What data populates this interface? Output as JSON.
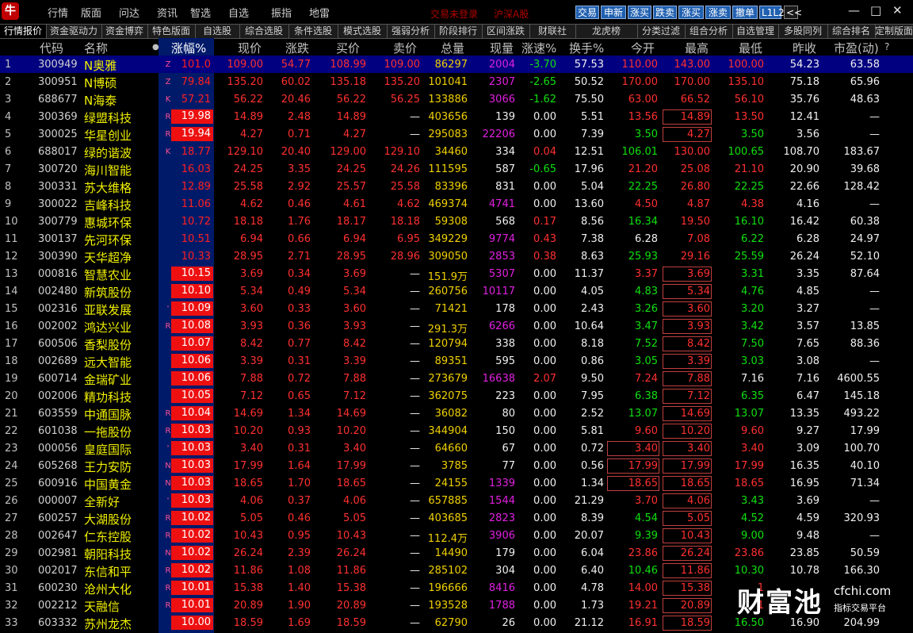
{
  "app": {
    "logo": "牛",
    "menu": [
      "行情",
      "版面",
      "问达",
      "资讯",
      "智选",
      "自选",
      "振指",
      "地雷"
    ],
    "status_left": "交易未登录",
    "status_right": "沪深A股",
    "buttons": [
      "交易",
      "申新",
      "涨买",
      "跌卖",
      "涨买",
      "涨卖",
      "撤单",
      "L1L2"
    ],
    "nav_icon": "chevron-left-icon",
    "win": [
      "—",
      "□",
      "✕"
    ]
  },
  "tabs": [
    "行情报价",
    "资金驱动力",
    "资金博弈",
    "特色版面",
    "自选股",
    "综合选股",
    "条件选股",
    "模式选股",
    "强弱分析",
    "阶段排行",
    "区间涨跌",
    "财联社",
    "龙虎榜",
    "分类过滤",
    "组合分析",
    "自选管理",
    "多股同列",
    "综合排名",
    "定制版面"
  ],
  "columns": [
    "代码",
    "名称",
    "",
    "涨幅%",
    "现价",
    "涨跌",
    "买价",
    "卖价",
    "总量",
    "现量",
    "涨速%",
    "换手%",
    "今开",
    "最高",
    "最低",
    "昨收",
    "市盈(动)",
    "?"
  ],
  "rows": [
    {
      "i": "1",
      "code": "300949",
      "name": "N奥雅",
      "tag": "Z",
      "pct": "101.0",
      "price": "109.00",
      "chg": "54.77",
      "bid": "108.99",
      "ask": "109.00",
      "vol": "86297",
      "cur": "2004",
      "spd": "-3.70",
      "turn": "57.53",
      "open": "110.00",
      "high": "143.00",
      "low": "100.00",
      "prev": "54.23",
      "pe": "63.58"
    },
    {
      "i": "2",
      "code": "300951",
      "name": "N博硕",
      "tag": "Z",
      "pct": "79.84",
      "price": "135.20",
      "chg": "60.02",
      "bid": "135.18",
      "ask": "135.20",
      "vol": "101041",
      "cur": "2307",
      "spd": "-2.65",
      "turn": "50.52",
      "open": "170.00",
      "high": "170.00",
      "low": "135.10",
      "prev": "75.18",
      "pe": "65.96"
    },
    {
      "i": "3",
      "code": "688677",
      "name": "N海泰",
      "tag": "K",
      "pct": "57.21",
      "price": "56.22",
      "chg": "20.46",
      "bid": "56.22",
      "ask": "56.25",
      "vol": "133886",
      "cur": "3066",
      "spd": "-1.62",
      "turn": "75.50",
      "open": "63.00",
      "high": "66.52",
      "low": "56.10",
      "prev": "35.76",
      "pe": "48.63"
    },
    {
      "i": "4",
      "code": "300369",
      "name": "绿盟科技",
      "tag": "R",
      "pct": "19.98",
      "price": "14.89",
      "chg": "2.48",
      "bid": "14.89",
      "ask": "—",
      "vol": "403656",
      "cur": "139",
      "spd": "0.00",
      "turn": "5.51",
      "open": "13.56",
      "high": "14.89",
      "low": "13.50",
      "prev": "12.41",
      "pe": "—"
    },
    {
      "i": "5",
      "code": "300025",
      "name": "华星创业",
      "tag": "R",
      "pct": "19.94",
      "price": "4.27",
      "chg": "0.71",
      "bid": "4.27",
      "ask": "—",
      "vol": "295083",
      "cur": "22206",
      "spd": "0.00",
      "turn": "7.39",
      "open": "3.50",
      "high": "4.27",
      "low": "3.50",
      "prev": "3.56",
      "pe": "—"
    },
    {
      "i": "6",
      "code": "688017",
      "name": "绿的谐波",
      "tag": "K",
      "pct": "18.77",
      "price": "129.10",
      "chg": "20.40",
      "bid": "129.00",
      "ask": "129.10",
      "vol": "34460",
      "cur": "334",
      "spd": "0.04",
      "turn": "12.51",
      "open": "106.01",
      "high": "130.00",
      "low": "100.65",
      "prev": "108.70",
      "pe": "183.67"
    },
    {
      "i": "7",
      "code": "300720",
      "name": "海川智能",
      "tag": "",
      "pct": "16.03",
      "price": "24.25",
      "chg": "3.35",
      "bid": "24.25",
      "ask": "24.26",
      "vol": "111595",
      "cur": "587",
      "spd": "-0.65",
      "turn": "17.96",
      "open": "21.20",
      "high": "25.08",
      "low": "21.10",
      "prev": "20.90",
      "pe": "39.68"
    },
    {
      "i": "8",
      "code": "300331",
      "name": "苏大维格",
      "tag": "",
      "pct": "12.89",
      "price": "25.58",
      "chg": "2.92",
      "bid": "25.57",
      "ask": "25.58",
      "vol": "83396",
      "cur": "831",
      "spd": "0.00",
      "turn": "5.04",
      "open": "22.25",
      "high": "26.80",
      "low": "22.25",
      "prev": "22.66",
      "pe": "128.42"
    },
    {
      "i": "9",
      "code": "300022",
      "name": "吉峰科技",
      "tag": "",
      "pct": "11.06",
      "price": "4.62",
      "chg": "0.46",
      "bid": "4.61",
      "ask": "4.62",
      "vol": "469374",
      "cur": "4741",
      "spd": "0.00",
      "turn": "13.60",
      "open": "4.50",
      "high": "4.87",
      "low": "4.38",
      "prev": "4.16",
      "pe": "—"
    },
    {
      "i": "10",
      "code": "300779",
      "name": "惠城环保",
      "tag": "",
      "pct": "10.72",
      "price": "18.18",
      "chg": "1.76",
      "bid": "18.17",
      "ask": "18.18",
      "vol": "59308",
      "cur": "568",
      "spd": "0.17",
      "turn": "8.56",
      "open": "16.34",
      "high": "19.50",
      "low": "16.10",
      "prev": "16.42",
      "pe": "60.38"
    },
    {
      "i": "11",
      "code": "300137",
      "name": "先河环保",
      "tag": "",
      "pct": "10.51",
      "price": "6.94",
      "chg": "0.66",
      "bid": "6.94",
      "ask": "6.95",
      "vol": "349229",
      "cur": "9774",
      "spd": "0.43",
      "turn": "7.38",
      "open": "6.28",
      "high": "7.08",
      "low": "6.22",
      "prev": "6.28",
      "pe": "24.97"
    },
    {
      "i": "12",
      "code": "300390",
      "name": "天华超净",
      "tag": "",
      "pct": "10.33",
      "price": "28.95",
      "chg": "2.71",
      "bid": "28.95",
      "ask": "28.96",
      "vol": "309050",
      "cur": "2853",
      "spd": "0.38",
      "turn": "8.63",
      "open": "25.93",
      "high": "29.16",
      "low": "25.59",
      "prev": "26.24",
      "pe": "52.10"
    },
    {
      "i": "13",
      "code": "000816",
      "name": "智慧农业",
      "tag": "",
      "pct": "10.15",
      "price": "3.69",
      "chg": "0.34",
      "bid": "3.69",
      "ask": "—",
      "vol": "151.9万",
      "cur": "5307",
      "spd": "0.00",
      "turn": "11.37",
      "open": "3.37",
      "high": "3.69",
      "low": "3.31",
      "prev": "3.35",
      "pe": "87.64"
    },
    {
      "i": "14",
      "code": "002480",
      "name": "新筑股份",
      "tag": "",
      "pct": "10.10",
      "price": "5.34",
      "chg": "0.49",
      "bid": "5.34",
      "ask": "—",
      "vol": "260756",
      "cur": "10117",
      "spd": "0.00",
      "turn": "4.05",
      "open": "4.83",
      "high": "5.34",
      "low": "4.76",
      "prev": "4.85",
      "pe": "—"
    },
    {
      "i": "15",
      "code": "002316",
      "name": "亚联发展",
      "tag": "'",
      "pct": "10.09",
      "price": "3.60",
      "chg": "0.33",
      "bid": "3.60",
      "ask": "—",
      "vol": "71421",
      "cur": "178",
      "spd": "0.00",
      "turn": "2.43",
      "open": "3.26",
      "high": "3.60",
      "low": "3.20",
      "prev": "3.27",
      "pe": "—"
    },
    {
      "i": "16",
      "code": "002002",
      "name": "鸿达兴业",
      "tag": "R",
      "pct": "10.08",
      "price": "3.93",
      "chg": "0.36",
      "bid": "3.93",
      "ask": "—",
      "vol": "291.3万",
      "cur": "6266",
      "spd": "0.00",
      "turn": "10.64",
      "open": "3.47",
      "high": "3.93",
      "low": "3.42",
      "prev": "3.57",
      "pe": "13.85"
    },
    {
      "i": "17",
      "code": "600506",
      "name": "香梨股份",
      "tag": "",
      "pct": "10.07",
      "price": "8.42",
      "chg": "0.77",
      "bid": "8.42",
      "ask": "—",
      "vol": "120794",
      "cur": "338",
      "spd": "0.00",
      "turn": "8.18",
      "open": "7.52",
      "high": "8.42",
      "low": "7.50",
      "prev": "7.65",
      "pe": "88.36"
    },
    {
      "i": "18",
      "code": "002689",
      "name": "远大智能",
      "tag": "",
      "pct": "10.06",
      "price": "3.39",
      "chg": "0.31",
      "bid": "3.39",
      "ask": "—",
      "vol": "89351",
      "cur": "595",
      "spd": "0.00",
      "turn": "0.86",
      "open": "3.05",
      "high": "3.39",
      "low": "3.03",
      "prev": "3.08",
      "pe": "—"
    },
    {
      "i": "19",
      "code": "600714",
      "name": "金瑞矿业",
      "tag": "",
      "pct": "10.06",
      "price": "7.88",
      "chg": "0.72",
      "bid": "7.88",
      "ask": "—",
      "vol": "273679",
      "cur": "16638",
      "spd": "2.07",
      "turn": "9.50",
      "open": "7.24",
      "high": "7.88",
      "low": "7.16",
      "prev": "7.16",
      "pe": "4600.55"
    },
    {
      "i": "20",
      "code": "002006",
      "name": "精功科技",
      "tag": "",
      "pct": "10.05",
      "price": "7.12",
      "chg": "0.65",
      "bid": "7.12",
      "ask": "—",
      "vol": "362075",
      "cur": "223",
      "spd": "0.00",
      "turn": "7.95",
      "open": "6.38",
      "high": "7.12",
      "low": "6.35",
      "prev": "6.47",
      "pe": "145.18"
    },
    {
      "i": "21",
      "code": "603559",
      "name": "中通国脉",
      "tag": "R",
      "pct": "10.04",
      "price": "14.69",
      "chg": "1.34",
      "bid": "14.69",
      "ask": "—",
      "vol": "36082",
      "cur": "80",
      "spd": "0.00",
      "turn": "2.52",
      "open": "13.07",
      "high": "14.69",
      "low": "13.07",
      "prev": "13.35",
      "pe": "493.22"
    },
    {
      "i": "22",
      "code": "601038",
      "name": "一拖股份",
      "tag": "R",
      "pct": "10.03",
      "price": "10.20",
      "chg": "0.93",
      "bid": "10.20",
      "ask": "—",
      "vol": "344904",
      "cur": "150",
      "spd": "0.00",
      "turn": "5.81",
      "open": "9.60",
      "high": "10.20",
      "low": "9.60",
      "prev": "9.27",
      "pe": "17.99"
    },
    {
      "i": "23",
      "code": "000056",
      "name": "皇庭国际",
      "tag": "'",
      "pct": "10.03",
      "price": "3.40",
      "chg": "0.31",
      "bid": "3.40",
      "ask": "—",
      "vol": "64660",
      "cur": "67",
      "spd": "0.00",
      "turn": "0.72",
      "open": "3.40",
      "high": "3.40",
      "low": "3.40",
      "prev": "3.09",
      "pe": "100.70"
    },
    {
      "i": "24",
      "code": "605268",
      "name": "王力安防",
      "tag": "N",
      "pct": "10.03",
      "price": "17.99",
      "chg": "1.64",
      "bid": "17.99",
      "ask": "—",
      "vol": "3785",
      "cur": "77",
      "spd": "0.00",
      "turn": "0.56",
      "open": "17.99",
      "high": "17.99",
      "low": "17.99",
      "prev": "16.35",
      "pe": "40.10"
    },
    {
      "i": "25",
      "code": "600916",
      "name": "中国黄金",
      "tag": "N",
      "pct": "10.03",
      "price": "18.65",
      "chg": "1.70",
      "bid": "18.65",
      "ask": "—",
      "vol": "24155",
      "cur": "1339",
      "spd": "0.00",
      "turn": "1.34",
      "open": "18.65",
      "high": "18.65",
      "low": "18.65",
      "prev": "16.95",
      "pe": "71.34"
    },
    {
      "i": "26",
      "code": "000007",
      "name": "全新好",
      "tag": "'",
      "pct": "10.03",
      "price": "4.06",
      "chg": "0.37",
      "bid": "4.06",
      "ask": "—",
      "vol": "657885",
      "cur": "1544",
      "spd": "0.00",
      "turn": "21.29",
      "open": "3.70",
      "high": "4.06",
      "low": "3.43",
      "prev": "3.69",
      "pe": "—"
    },
    {
      "i": "27",
      "code": "600257",
      "name": "大湖股份",
      "tag": "R",
      "pct": "10.02",
      "price": "5.05",
      "chg": "0.46",
      "bid": "5.05",
      "ask": "—",
      "vol": "403685",
      "cur": "2823",
      "spd": "0.00",
      "turn": "8.39",
      "open": "4.54",
      "high": "5.05",
      "low": "4.52",
      "prev": "4.59",
      "pe": "320.93"
    },
    {
      "i": "28",
      "code": "002647",
      "name": "仁东控股",
      "tag": "R",
      "pct": "10.02",
      "price": "10.43",
      "chg": "0.95",
      "bid": "10.43",
      "ask": "—",
      "vol": "112.4万",
      "cur": "3906",
      "spd": "0.00",
      "turn": "20.07",
      "open": "9.39",
      "high": "10.43",
      "low": "9.00",
      "prev": "9.48",
      "pe": "—"
    },
    {
      "i": "29",
      "code": "002981",
      "name": "朝阳科技",
      "tag": "N",
      "pct": "10.02",
      "price": "26.24",
      "chg": "2.39",
      "bid": "26.24",
      "ask": "—",
      "vol": "14490",
      "cur": "179",
      "spd": "0.00",
      "turn": "6.04",
      "open": "23.86",
      "high": "26.24",
      "low": "23.86",
      "prev": "23.85",
      "pe": "50.59"
    },
    {
      "i": "30",
      "code": "002017",
      "name": "东信和平",
      "tag": "R",
      "pct": "10.02",
      "price": "11.86",
      "chg": "1.08",
      "bid": "11.86",
      "ask": "—",
      "vol": "285102",
      "cur": "304",
      "spd": "0.00",
      "turn": "6.40",
      "open": "10.46",
      "high": "11.86",
      "low": "10.30",
      "prev": "10.78",
      "pe": "166.30"
    },
    {
      "i": "31",
      "code": "600230",
      "name": "沧州大化",
      "tag": "R",
      "pct": "10.01",
      "price": "15.38",
      "chg": "1.40",
      "bid": "15.38",
      "ask": "—",
      "vol": "196666",
      "cur": "8416",
      "spd": "0.00",
      "turn": "4.78",
      "open": "14.00",
      "high": "15.38",
      "low": "1",
      "prev": "",
      "pe": ""
    },
    {
      "i": "32",
      "code": "002212",
      "name": "天融信",
      "tag": "R",
      "pct": "10.01",
      "price": "20.89",
      "chg": "1.90",
      "bid": "20.89",
      "ask": "—",
      "vol": "193528",
      "cur": "1788",
      "spd": "0.00",
      "turn": "1.73",
      "open": "19.21",
      "high": "20.89",
      "low": "1",
      "prev": "",
      "pe": ""
    },
    {
      "i": "33",
      "code": "603332",
      "name": "苏州龙杰",
      "tag": "",
      "pct": "10.00",
      "price": "18.59",
      "chg": "1.69",
      "bid": "18.59",
      "ask": "—",
      "vol": "62790",
      "cur": "26",
      "spd": "0.00",
      "turn": "21.12",
      "open": "16.91",
      "high": "18.59",
      "low": "16.50",
      "prev": "16.90",
      "pe": "204.99"
    }
  ],
  "watermark": {
    "brand": "财富池",
    "domain": "cfchi.com",
    "slogan": "指标交易平台"
  }
}
